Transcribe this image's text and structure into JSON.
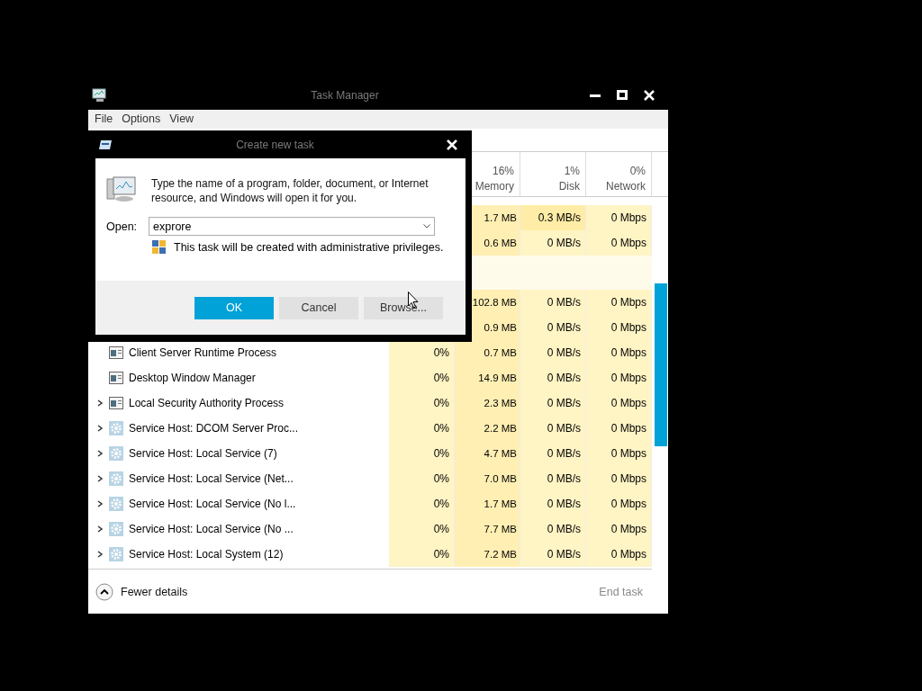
{
  "window": {
    "title": "Task Manager"
  },
  "menu": [
    "File",
    "Options",
    "View"
  ],
  "columns": [
    {
      "percent": "16%",
      "label": "Memory"
    },
    {
      "percent": "1%",
      "label": "Disk"
    },
    {
      "percent": "0%",
      "label": "Network"
    }
  ],
  "rows": [
    {
      "kind": "process",
      "memory": "1.7 MB",
      "disk": "0.3 MB/s",
      "network": "0 Mbps"
    },
    {
      "kind": "process",
      "memory": "0.6 MB",
      "disk": "0 MB/s",
      "network": "0 Mbps"
    },
    {
      "kind": "group"
    },
    {
      "kind": "process",
      "memory": "102.8 MB",
      "disk": "0 MB/s",
      "network": "0 Mbps"
    },
    {
      "kind": "process",
      "memory": "0.9 MB",
      "disk": "0 MB/s",
      "network": "0 Mbps"
    },
    {
      "kind": "app",
      "name": "Client Server Runtime Process",
      "expandable": false,
      "cpu": "0%",
      "memory": "0.7 MB",
      "disk": "0 MB/s",
      "network": "0 Mbps"
    },
    {
      "kind": "app",
      "name": "Desktop Window Manager",
      "expandable": false,
      "cpu": "0%",
      "memory": "14.9 MB",
      "disk": "0 MB/s",
      "network": "0 Mbps"
    },
    {
      "kind": "app",
      "name": "Local Security Authority Process",
      "expandable": true,
      "cpu": "0%",
      "memory": "2.3 MB",
      "disk": "0 MB/s",
      "network": "0 Mbps"
    },
    {
      "kind": "service",
      "name": "Service Host: DCOM Server Proc...",
      "expandable": true,
      "cpu": "0%",
      "memory": "2.2 MB",
      "disk": "0 MB/s",
      "network": "0 Mbps"
    },
    {
      "kind": "service",
      "name": "Service Host: Local Service (7)",
      "expandable": true,
      "cpu": "0%",
      "memory": "4.7 MB",
      "disk": "0 MB/s",
      "network": "0 Mbps"
    },
    {
      "kind": "service",
      "name": "Service Host: Local Service (Net...",
      "expandable": true,
      "cpu": "0%",
      "memory": "7.0 MB",
      "disk": "0 MB/s",
      "network": "0 Mbps"
    },
    {
      "kind": "service",
      "name": "Service Host: Local Service (No l...",
      "expandable": true,
      "cpu": "0%",
      "memory": "1.7 MB",
      "disk": "0 MB/s",
      "network": "0 Mbps"
    },
    {
      "kind": "service",
      "name": "Service Host: Local Service (No ...",
      "expandable": true,
      "cpu": "0%",
      "memory": "7.7 MB",
      "disk": "0 MB/s",
      "network": "0 Mbps"
    },
    {
      "kind": "service",
      "name": "Service Host: Local System (12)",
      "expandable": true,
      "cpu": "0%",
      "memory": "7.2 MB",
      "disk": "0 MB/s",
      "network": "0 Mbps"
    }
  ],
  "footer": {
    "details_link": "Fewer details",
    "end_task": {
      "label": "End task",
      "disabled": true
    }
  },
  "dialog": {
    "title": "Create new task",
    "message": "Type the name of a program, folder, document, or Internet resource, and Windows will open it for you.",
    "open_label": "Open:",
    "open_value": "exprore",
    "admin_note": "This task will be created with administrative privileges.",
    "buttons": [
      {
        "label": "OK",
        "kind": "primary"
      },
      {
        "label": "Cancel",
        "kind": "normal"
      },
      {
        "label": "Browse...",
        "kind": "normal"
      }
    ]
  }
}
